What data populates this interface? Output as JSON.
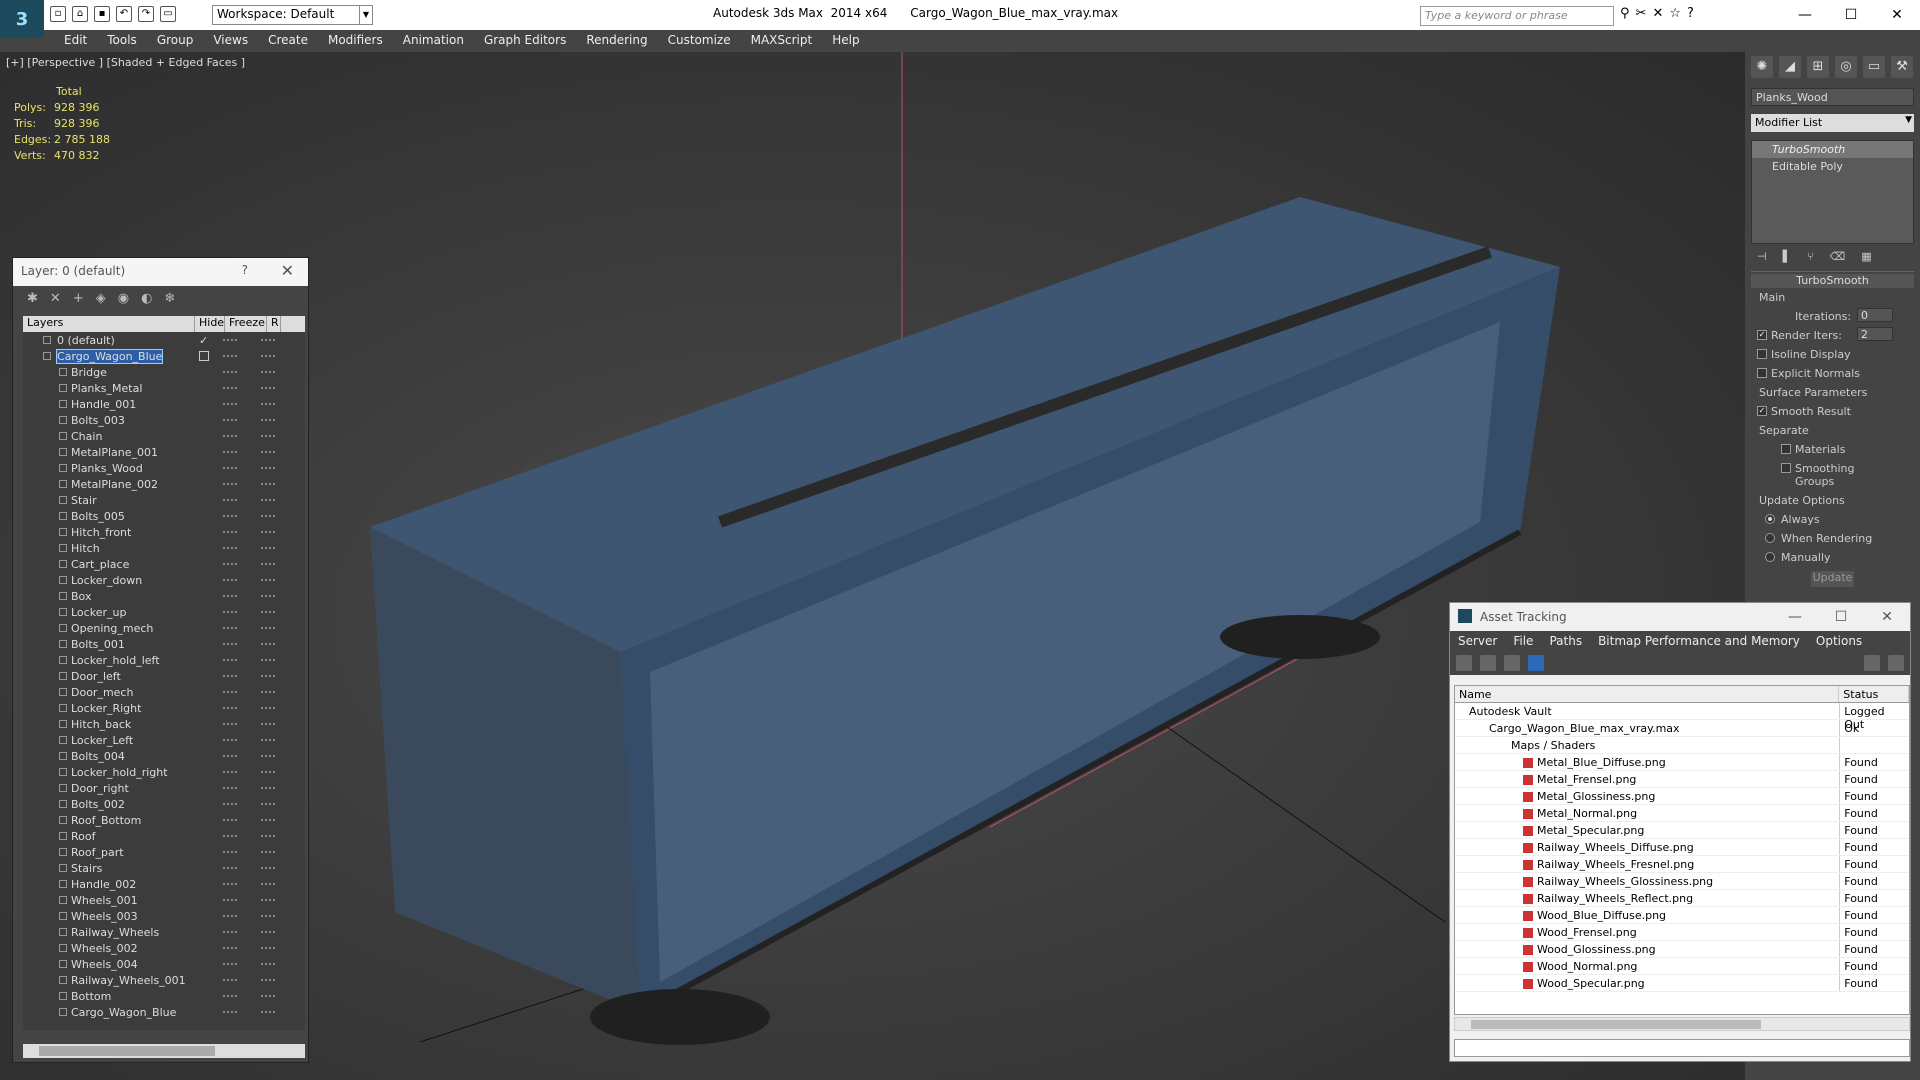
{
  "app": {
    "title": "Autodesk 3ds Max  2014 x64      Cargo_Wagon_Blue_max_vray.max",
    "workspace": "Workspace: Default",
    "search_placeholder": "Type a keyword or phrase"
  },
  "menu": [
    "Edit",
    "Tools",
    "Group",
    "Views",
    "Create",
    "Modifiers",
    "Animation",
    "Graph Editors",
    "Rendering",
    "Customize",
    "MAXScript",
    "Help"
  ],
  "viewport": {
    "label": "[+] [Perspective ] [Shaded + Edged Faces ]",
    "stats_header": "Total",
    "stats": [
      {
        "k": "Polys:",
        "v": "928 396"
      },
      {
        "k": "Tris:",
        "v": "928 396"
      },
      {
        "k": "Edges:",
        "v": "2 785 188"
      },
      {
        "k": "Verts:",
        "v": "470 832"
      }
    ]
  },
  "layer_window": {
    "title": "Layer: 0 (default)",
    "help": "?",
    "col_layers": "Layers",
    "col_hide": "Hide",
    "col_freeze": "Freeze",
    "col_r": "R",
    "default_layer": "0 (default)",
    "selected_layer": "Cargo_Wagon_Blue",
    "objects": [
      "Bridge",
      "Planks_Metal",
      "Handle_001",
      "Bolts_003",
      "Chain",
      "MetalPlane_001",
      "Planks_Wood",
      "MetalPlane_002",
      "Stair",
      "Bolts_005",
      "Hitch_front",
      "Hitch",
      "Cart_place",
      "Locker_down",
      "Box",
      "Locker_up",
      "Opening_mech",
      "Bolts_001",
      "Locker_hold_left",
      "Door_left",
      "Door_mech",
      "Locker_Right",
      "Hitch_back",
      "Locker_Left",
      "Bolts_004",
      "Locker_hold_right",
      "Door_right",
      "Bolts_002",
      "Roof_Bottom",
      "Roof",
      "Roof_part",
      "Stairs",
      "Handle_002",
      "Wheels_001",
      "Wheels_003",
      "Railway_Wheels",
      "Wheels_002",
      "Wheels_004",
      "Railway_Wheels_001",
      "Bottom",
      "Cargo_Wagon_Blue"
    ]
  },
  "command_panel": {
    "object_name": "Planks_Wood",
    "modifier_list": "Modifier List",
    "stack": [
      "TurboSmooth",
      "Editable Poly"
    ],
    "rollout_title": "TurboSmooth",
    "main_label": "Main",
    "iterations_label": "Iterations:",
    "iterations": "0",
    "render_iters_label": "Render Iters:",
    "render_iters": "2",
    "isoline": "Isoline Display",
    "explicit_normals": "Explicit Normals",
    "surface_params": "Surface Parameters",
    "smooth_result": "Smooth Result",
    "separate": "Separate",
    "materials": "Materials",
    "smoothing_groups": "Smoothing Groups",
    "update_options": "Update Options",
    "always": "Always",
    "when_rendering": "When Rendering",
    "manually": "Manually",
    "update_btn": "Update"
  },
  "asset_tracking": {
    "title": "Asset Tracking",
    "menu": [
      "Server",
      "File",
      "Paths",
      "Bitmap Performance and Memory",
      "Options"
    ],
    "col_name": "Name",
    "col_status": "Status",
    "vault": {
      "name": "Autodesk Vault",
      "status": "Logged Out"
    },
    "file": {
      "name": "Cargo_Wagon_Blue_max_vray.max",
      "status": "Ok"
    },
    "maps": {
      "name": "Maps / Shaders",
      "status": ""
    },
    "textures": [
      {
        "name": "Metal_Blue_Diffuse.png",
        "status": "Found"
      },
      {
        "name": "Metal_Frensel.png",
        "status": "Found"
      },
      {
        "name": "Metal_Glossiness.png",
        "status": "Found"
      },
      {
        "name": "Metal_Normal.png",
        "status": "Found"
      },
      {
        "name": "Metal_Specular.png",
        "status": "Found"
      },
      {
        "name": "Railway_Wheels_Diffuse.png",
        "status": "Found"
      },
      {
        "name": "Railway_Wheels_Fresnel.png",
        "status": "Found"
      },
      {
        "name": "Railway_Wheels_Glossiness.png",
        "status": "Found"
      },
      {
        "name": "Railway_Wheels_Reflect.png",
        "status": "Found"
      },
      {
        "name": "Wood_Blue_Diffuse.png",
        "status": "Found"
      },
      {
        "name": "Wood_Frensel.png",
        "status": "Found"
      },
      {
        "name": "Wood_Glossiness.png",
        "status": "Found"
      },
      {
        "name": "Wood_Normal.png",
        "status": "Found"
      },
      {
        "name": "Wood_Specular.png",
        "status": "Found"
      }
    ]
  }
}
